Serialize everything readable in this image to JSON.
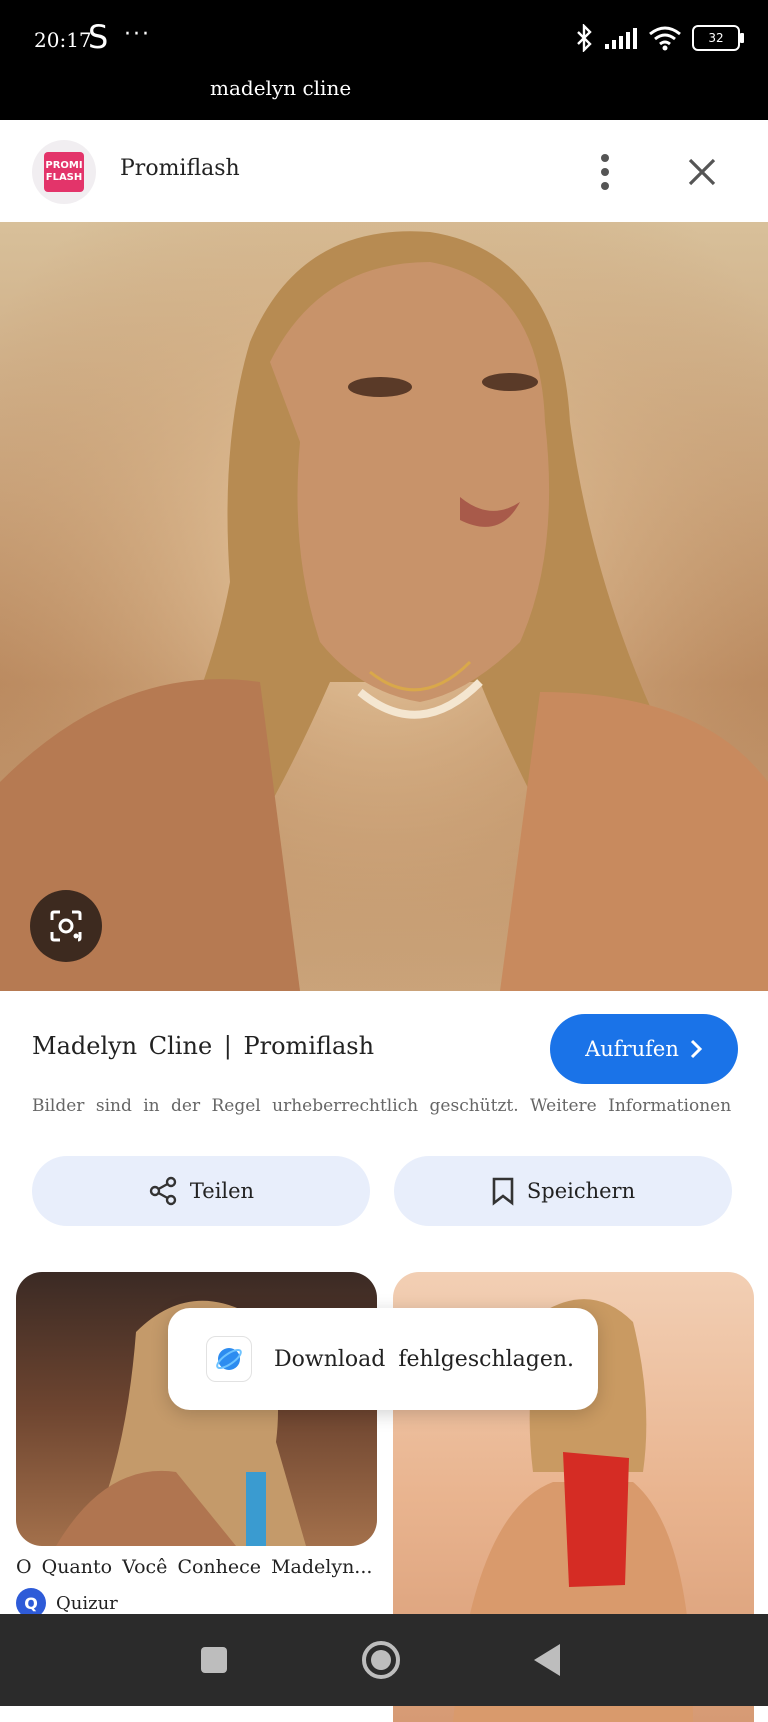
{
  "status_bar": {
    "time": "20:17",
    "app_letter": "S",
    "more_dots": "···",
    "battery": "32"
  },
  "search": {
    "query": "madelyn cline"
  },
  "source": {
    "name": "Promiflash",
    "logo_line1": "PROMI",
    "logo_line2": "FLASH"
  },
  "image": {
    "title": "Madelyn Cline | Promiflash",
    "visit_label": "Aufrufen",
    "copyright": "Bilder sind in der Regel urheberrechtlich geschützt. Weitere Informationen"
  },
  "actions": {
    "share_label": "Teilen",
    "save_label": "Speichern"
  },
  "related": [
    {
      "caption": "O Quanto Você Conhece Madelyn...",
      "source": "Quizur",
      "source_initial": "Q"
    },
    {
      "caption": "",
      "source": ""
    }
  ],
  "toast": {
    "message": "Download fehlgeschlagen."
  },
  "colors": {
    "accent": "#1a73e8",
    "chip_bg": "#e8eefb",
    "brand_logo": "#e3346a"
  }
}
